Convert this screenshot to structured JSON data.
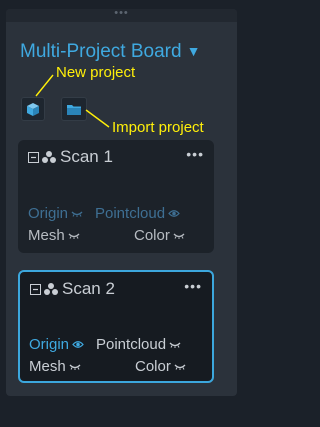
{
  "panel": {
    "handle_glyph": "•••",
    "title": "Multi-Project Board",
    "title_caret": "▼"
  },
  "toolbar": {
    "new_project_icon": "cube-icon",
    "import_project_icon": "folder-icon"
  },
  "annotations": {
    "new_project": "New project",
    "import_project": "Import project"
  },
  "colors": {
    "accent": "#3fa9e0",
    "annotation": "#ffef0a",
    "panel_bg": "#2b323b",
    "card_bg": "#1c2229"
  },
  "cards": [
    {
      "name": "Scan 1",
      "selected": false,
      "menu": "•••",
      "layers": {
        "origin": "Origin",
        "pointcloud": "Pointcloud",
        "mesh": "Mesh",
        "color": "Color"
      },
      "visibility": {
        "origin": "hidden",
        "pointcloud": "visible",
        "mesh": "hidden",
        "color": "hidden"
      }
    },
    {
      "name": "Scan 2",
      "selected": true,
      "menu": "•••",
      "layers": {
        "origin": "Origin",
        "pointcloud": "Pointcloud",
        "mesh": "Mesh",
        "color": "Color"
      },
      "visibility": {
        "origin": "visible",
        "pointcloud": "hidden",
        "mesh": "hidden",
        "color": "hidden"
      }
    }
  ]
}
